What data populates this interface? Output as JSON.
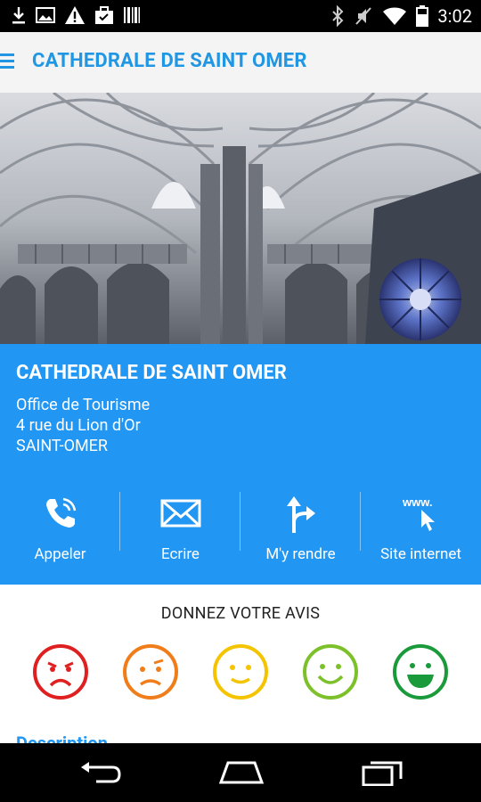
{
  "status_bar": {
    "time": "3:02",
    "left_icons": [
      "download-icon",
      "image-icon",
      "warning-icon",
      "briefcase-icon",
      "barcode-icon"
    ],
    "right_icons": [
      "bluetooth-icon",
      "mute-icon",
      "wifi-icon",
      "battery-icon"
    ]
  },
  "app_bar": {
    "title": "CATHEDRALE DE SAINT OMER",
    "accent": "#2196e3"
  },
  "hero": {
    "page_count": 2,
    "current_page": 1
  },
  "info": {
    "title": "CATHEDRALE DE SAINT OMER",
    "address": [
      "Office de Tourisme",
      "4 rue du Lion d'Or",
      "SAINT-OMER"
    ],
    "background": "#2196f3",
    "actions": [
      {
        "label": "Appeler",
        "icon": "phone-icon"
      },
      {
        "label": "Ecrire",
        "icon": "envelope-icon"
      },
      {
        "label": "M'y rendre",
        "icon": "directions-icon"
      },
      {
        "label": "Site internet",
        "icon": "www-icon"
      }
    ]
  },
  "rating": {
    "heading": "DONNEZ VOTRE AVIS",
    "options": [
      {
        "icon": "angry-face-icon",
        "color": "#e02020"
      },
      {
        "icon": "sad-face-icon",
        "color": "#f07d1a"
      },
      {
        "icon": "neutral-smile-icon",
        "color": "#f5c400"
      },
      {
        "icon": "happy-face-icon",
        "color": "#7cc12a"
      },
      {
        "icon": "laughing-face-icon",
        "color": "#1a9a3a"
      }
    ]
  },
  "section": {
    "title": "Description"
  }
}
